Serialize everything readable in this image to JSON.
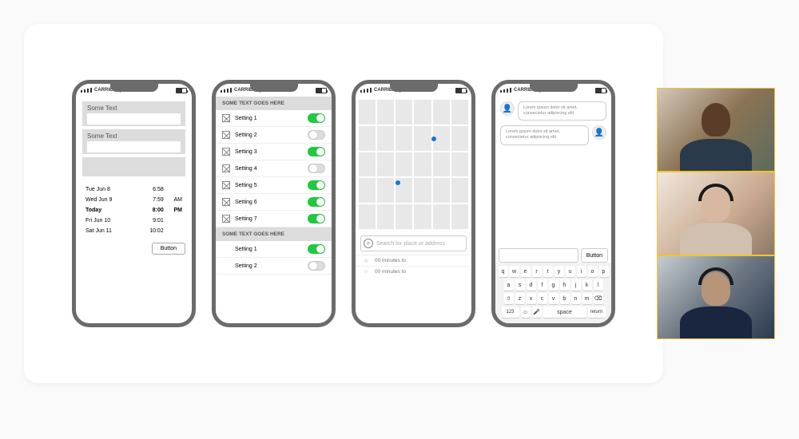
{
  "statusbar": {
    "carrier": "CARRIER"
  },
  "phone1": {
    "field1_label": "Some Text",
    "field2_label": "Some Text",
    "rows": [
      {
        "day": "Tue Jun 8",
        "time": "6:58",
        "ampm": ""
      },
      {
        "day": "Wed Jun 9",
        "time": "7:59",
        "ampm": "AM"
      },
      {
        "day": "Today",
        "time": "8:00",
        "ampm": "PM"
      },
      {
        "day": "Fri Jun 10",
        "time": "9:01",
        "ampm": ""
      },
      {
        "day": "Sat Jun 11",
        "time": "10:02",
        "ampm": ""
      }
    ],
    "button": "Button"
  },
  "phone2": {
    "header1": "SOME TEXT GOES HERE",
    "group1": [
      {
        "label": "Setting 1",
        "on": true
      },
      {
        "label": "Setting 2",
        "on": false
      },
      {
        "label": "Setting 3",
        "on": true
      },
      {
        "label": "Setting 4",
        "on": false
      },
      {
        "label": "Setting 5",
        "on": true
      },
      {
        "label": "Setting 6",
        "on": true
      },
      {
        "label": "Setting 7",
        "on": true
      }
    ],
    "header2": "SOME TEXT GOES HERE",
    "group2": [
      {
        "label": "Setting 1",
        "on": true
      },
      {
        "label": "Setting 2",
        "on": false
      }
    ]
  },
  "phone3": {
    "search_placeholder": "Search for place or address",
    "dest1": "00 minutes to",
    "dest2": "00 minutes to"
  },
  "phone4": {
    "msg1": "Lorem ipsum dolor sit amet, consectetur adipiscing elit",
    "msg2": "Lorem ipsum dolor sit amet, consectetur adipiscing elit",
    "button": "Button",
    "keyboard": {
      "r1": [
        "q",
        "w",
        "e",
        "r",
        "t",
        "y",
        "u",
        "i",
        "o",
        "p"
      ],
      "r2": [
        "a",
        "s",
        "d",
        "f",
        "g",
        "h",
        "j",
        "k",
        "l"
      ],
      "r3": [
        "⇧",
        "z",
        "x",
        "c",
        "v",
        "b",
        "n",
        "m",
        "⌫"
      ],
      "r4_123": "123",
      "r4_space": "space",
      "r4_return": "return"
    }
  }
}
